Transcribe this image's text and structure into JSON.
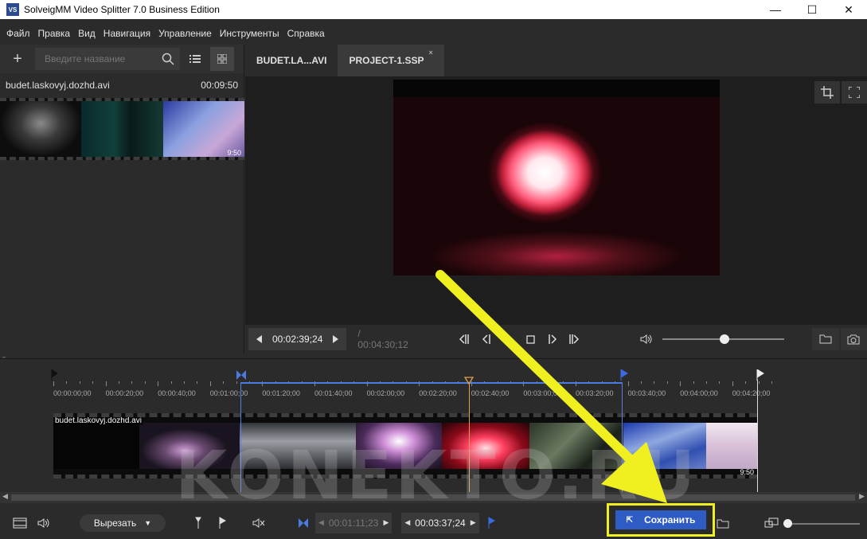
{
  "window": {
    "logo_text": "VS",
    "title": "SolveigMM Video Splitter 7.0 Business Edition",
    "minimize": "—",
    "maximize": "☐",
    "close": "✕"
  },
  "menu": {
    "items": [
      "Файл",
      "Правка",
      "Вид",
      "Навигация",
      "Управление",
      "Инструменты",
      "Справка"
    ]
  },
  "library": {
    "add": "+",
    "search_placeholder": "Введите название",
    "file_name": "budet.laskovyj.dozhd.avi",
    "file_duration": "00:09:50",
    "thumb_duration": "9:50"
  },
  "tabs": [
    {
      "label": "BUDET.LA...AVI"
    },
    {
      "label": "PROJECT-1.SSP",
      "close": "×"
    }
  ],
  "player": {
    "current_time": "00:02:39;24",
    "total_time": "/ 00:04:30;12"
  },
  "timeline": {
    "ticks": [
      "00:00:00;00",
      "00:00:20;00",
      "00:00:40;00",
      "00:01:00;00",
      "00:01:20;00",
      "00:01:40;00",
      "00:02:00;00",
      "00:02:20;00",
      "00:02:40;00",
      "00:03:00;00",
      "00:03:20;00",
      "00:03:40;00",
      "00:04:00;00",
      "00:04:20;00"
    ],
    "track_name": "budet.laskovyj.dozhd.avi",
    "track_duration": "9:50"
  },
  "bottom": {
    "cut_label": "Вырезать",
    "start_time": "00:01:11;23",
    "end_time": "00:03:37;24",
    "save_label": "Сохранить"
  },
  "watermark": "KONEKTO.RU",
  "colors": {
    "accent": "#2e5bc4",
    "highlight": "#f0f020",
    "marker": "#4a7be0",
    "playhead": "#e0a050"
  }
}
